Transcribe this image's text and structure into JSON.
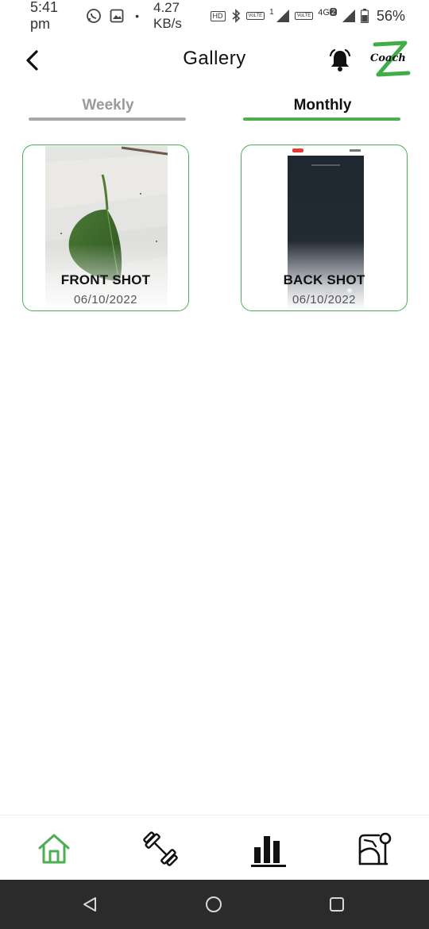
{
  "status_bar": {
    "time": "5:41 pm",
    "net_speed": "4.27 KB/s",
    "dot": "•",
    "battery": "56%",
    "hd_badge": "HD",
    "volte1_badge": "VoLTE",
    "volte2_badge": "VoLTE",
    "network_4g": "4G",
    "sim_indicator": "1",
    "sim2_badge": "2"
  },
  "header": {
    "title": "Gallery",
    "logo_text": "Coach"
  },
  "tabs": [
    {
      "label": "Weekly",
      "active": false
    },
    {
      "label": "Monthly",
      "active": true
    }
  ],
  "gallery": [
    {
      "title": "FRONT SHOT",
      "date": "06/10/2022"
    },
    {
      "title": "BACK SHOT",
      "date": "06/10/2022"
    }
  ],
  "colors": {
    "accent": "#4caf50",
    "inactive_tab": "#a8a8a8",
    "system_nav_bg": "#2b2b2b"
  },
  "icons": {
    "back": "chevron-left-icon",
    "notifications": "bell-icon",
    "home": "home-icon",
    "workout": "dumbbell-icon",
    "stats": "bar-chart-icon",
    "progress": "body-progress-icon"
  }
}
